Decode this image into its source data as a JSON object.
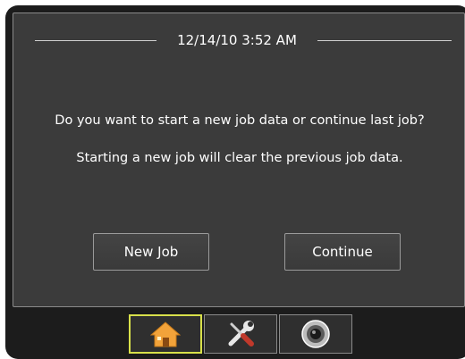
{
  "header": {
    "datetime": "12/14/10 3:52 AM"
  },
  "dialog": {
    "question": "Do you want to start a new job data or continue last job?",
    "warning": "Starting a new job will clear the previous job data.",
    "new_job_label": "New Job",
    "continue_label": "Continue"
  },
  "tabs": [
    {
      "icon": "home-icon",
      "selected": true
    },
    {
      "icon": "tools-icon",
      "selected": false
    },
    {
      "icon": "camera-icon",
      "selected": false
    }
  ],
  "colors": {
    "screen_bg": "#3b3b3b",
    "selected_tab_border": "#d8e04a",
    "home_icon": "#f2a33a"
  }
}
